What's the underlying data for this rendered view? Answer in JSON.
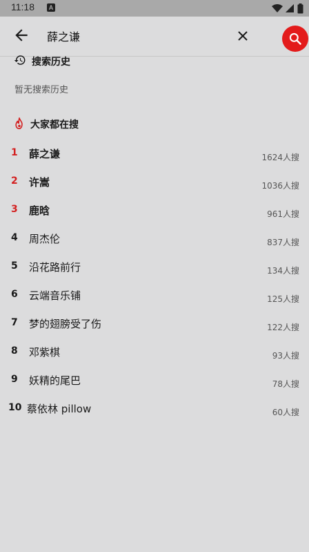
{
  "status": {
    "time": "11:18",
    "notif": "A"
  },
  "search": {
    "query": "薛之谦"
  },
  "history": {
    "title": "搜索历史",
    "empty": "暂无搜索历史"
  },
  "hot": {
    "title": "大家都在搜",
    "items": [
      {
        "rank": "1",
        "name": "薛之谦",
        "count": "1624人搜"
      },
      {
        "rank": "2",
        "name": "许嵩",
        "count": "1036人搜"
      },
      {
        "rank": "3",
        "name": "鹿晗",
        "count": "961人搜"
      },
      {
        "rank": "4",
        "name": "周杰伦",
        "count": "837人搜"
      },
      {
        "rank": "5",
        "name": "沿花路前行",
        "count": "134人搜"
      },
      {
        "rank": "6",
        "name": "云端音乐铺",
        "count": "125人搜"
      },
      {
        "rank": "7",
        "name": "梦的翅膀受了伤",
        "count": "122人搜"
      },
      {
        "rank": "8",
        "name": "邓紫棋",
        "count": "93人搜"
      },
      {
        "rank": "9",
        "name": "妖精的尾巴",
        "count": "78人搜"
      },
      {
        "rank": "10",
        "name": "蔡依林 pillow",
        "count": "60人搜"
      }
    ]
  },
  "colors": {
    "accent": "#e31b1b",
    "rank_top": "#d32020",
    "background": "#dcdcdd",
    "statusbar": "#a9a9a9"
  }
}
